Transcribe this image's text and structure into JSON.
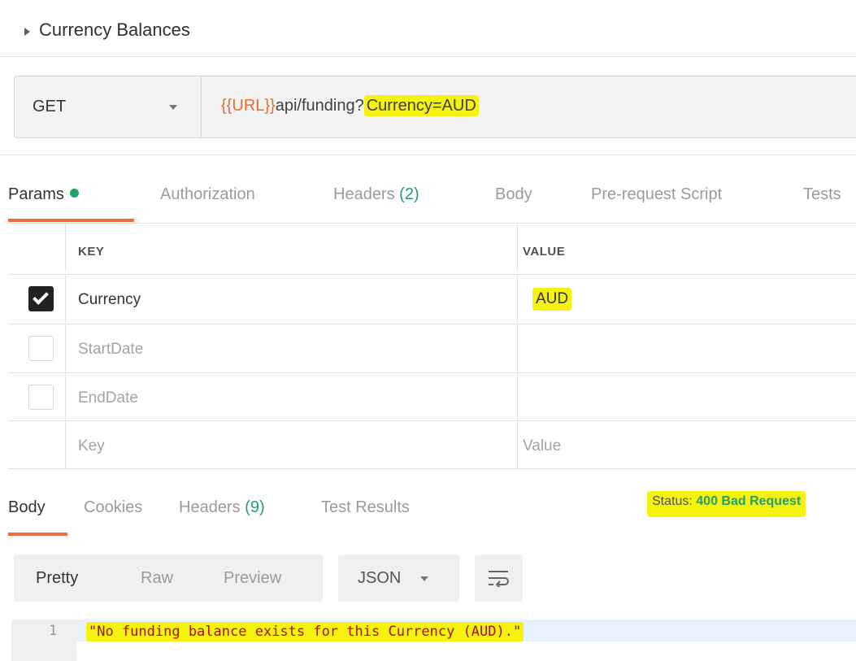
{
  "collection": {
    "title": "Currency Balances"
  },
  "request": {
    "method": "GET",
    "url_variable": "{{URL}}",
    "url_path": "api/funding?",
    "url_query": "Currency=AUD"
  },
  "request_tabs": {
    "params": "Params",
    "authorization": "Authorization",
    "headers": "Headers",
    "headers_count": "(2)",
    "body": "Body",
    "prerequest": "Pre-request Script",
    "tests": "Tests"
  },
  "params_table": {
    "key_header": "KEY",
    "value_header": "VALUE",
    "rows": [
      {
        "key": "Currency",
        "value": "AUD",
        "checked": true
      },
      {
        "key": "StartDate",
        "value": "",
        "checked": false
      },
      {
        "key": "EndDate",
        "value": "",
        "checked": false
      }
    ],
    "new_key_placeholder": "Key",
    "new_value_placeholder": "Value"
  },
  "response_tabs": {
    "body": "Body",
    "cookies": "Cookies",
    "headers": "Headers",
    "headers_count": "(9)",
    "test_results": "Test Results"
  },
  "status": {
    "label": "Status:",
    "value": "400 Bad Request"
  },
  "response_view": {
    "pretty": "Pretty",
    "raw": "Raw",
    "preview": "Preview",
    "format": "JSON"
  },
  "response_body": {
    "line_number": "1",
    "text": "\"No funding balance exists for this Currency (AUD).\""
  },
  "colors": {
    "accent_orange": "#f26b3a",
    "status_green": "#24a06b",
    "highlight_yellow": "#f4f20e"
  }
}
